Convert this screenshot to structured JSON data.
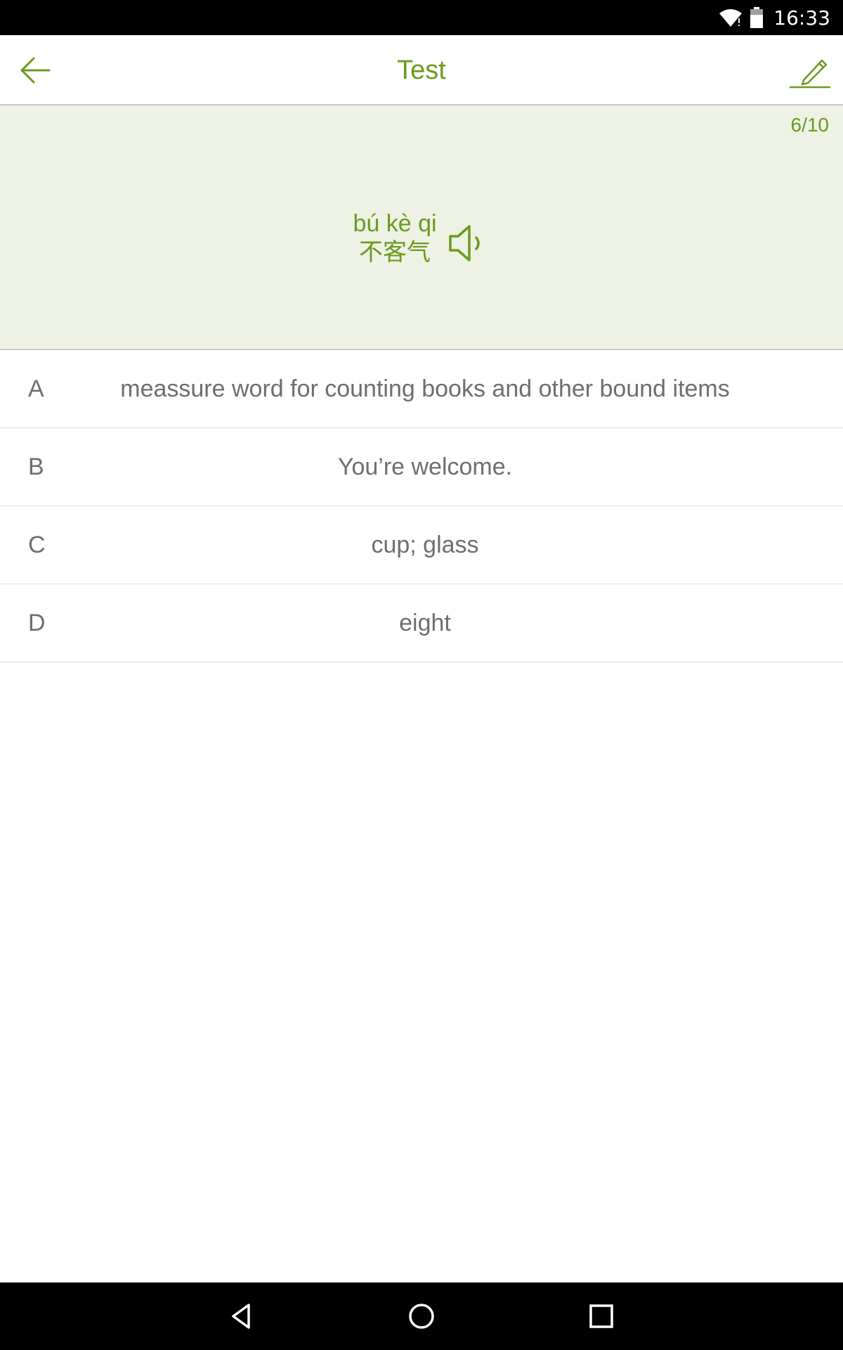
{
  "status_bar": {
    "time": "16:33",
    "icons": [
      "wifi-icon",
      "battery-icon"
    ]
  },
  "app_bar": {
    "title": "Test",
    "back_icon": "arrow-left-icon",
    "edit_icon": "pencil-icon"
  },
  "question": {
    "progress": "6/10",
    "pinyin": "bú kè qi",
    "hanzi": "不客气",
    "audio_icon": "speaker-icon"
  },
  "options": [
    {
      "letter": "A",
      "text": "meassure word for counting books and other bound items"
    },
    {
      "letter": "B",
      "text": "You’re welcome."
    },
    {
      "letter": "C",
      "text": "cup; glass"
    },
    {
      "letter": "D",
      "text": "eight"
    }
  ],
  "nav_bar": {
    "icons": [
      "back-triangle-icon",
      "home-circle-icon",
      "recents-square-icon"
    ]
  },
  "colors": {
    "accent": "#6b9a1e",
    "panel_bg": "#eef2e4",
    "option_text": "#6e6e6e"
  }
}
